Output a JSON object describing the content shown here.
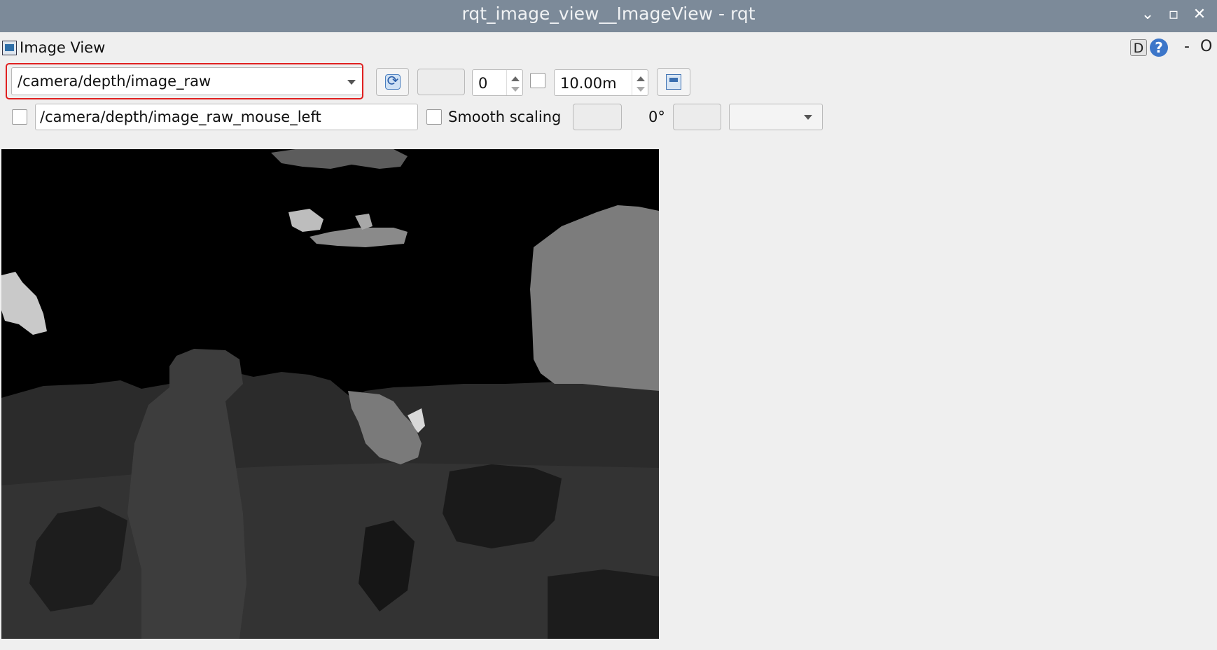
{
  "window": {
    "title": "rqt_image_view__ImageView - rqt",
    "controls": {
      "minimize": "⌄",
      "maximize": "▫",
      "close": "✕"
    }
  },
  "dock": {
    "title": "Image View",
    "d_button": "D",
    "help_button": "?",
    "minus_button": "-",
    "float_button": "O"
  },
  "toolbar": {
    "topic_selected": "/camera/depth/image_raw",
    "rotate_spin_value": "0",
    "max_range_value": "10.00m",
    "mouse_topic_value": "/camera/depth/image_raw_mouse_left",
    "smooth_scaling_label": "Smooth scaling",
    "rotation_label": "0°"
  },
  "icons": {
    "refresh": "refresh-icon",
    "save": "save-image-icon",
    "image_view": "image-view-icon",
    "help": "help-icon"
  },
  "colors": {
    "titlebar": "#7c8a99",
    "highlight": "#e02020",
    "background": "#efefef",
    "image_bg": "#000000"
  }
}
